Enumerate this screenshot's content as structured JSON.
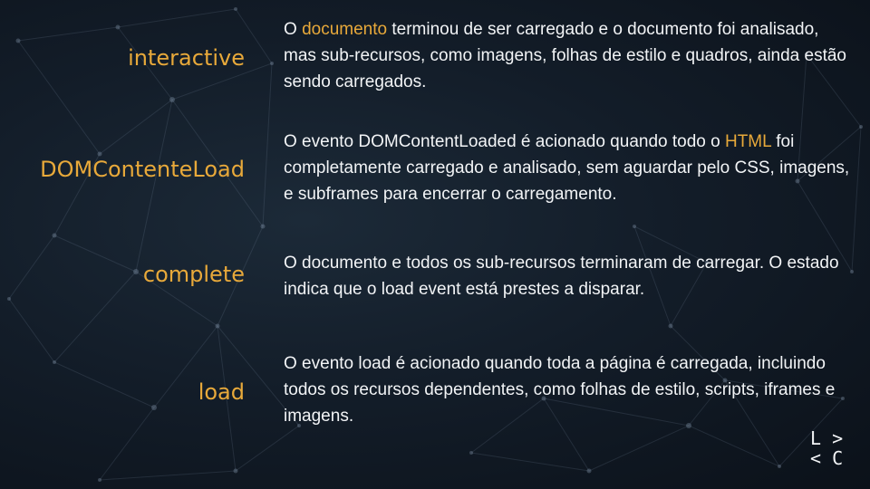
{
  "colors": {
    "accent": "#e8a93a",
    "text": "#f2f4f6",
    "background": "#131d29"
  },
  "items": [
    {
      "term": "interactive",
      "desc_before": "O ",
      "desc_highlight": "documento",
      "desc_after": " terminou de ser carregado e o documento foi analisado, mas sub-recursos, como imagens, folhas de estilo e quadros, ainda estão sendo carregados."
    },
    {
      "term": "DOMContenteLoad",
      "desc_before": "O evento DOMContentLoaded é acionado quando todo o ",
      "desc_highlight": "HTML",
      "desc_after": " foi completamente carregado e analisado, sem aguardar pelo CSS, imagens, e subframes para encerrar o carregamento."
    },
    {
      "term": "complete",
      "desc": "O documento e todos os sub-recursos terminaram de carregar. O estado indica que o load event está prestes a disparar."
    },
    {
      "term": "load",
      "desc": "O evento load é acionado quando toda a página é carregada, incluindo todos os recursos dependentes, como folhas de estilo, scripts, iframes e imagens."
    }
  ],
  "logo": {
    "line1": "L >",
    "line2": "< C"
  }
}
